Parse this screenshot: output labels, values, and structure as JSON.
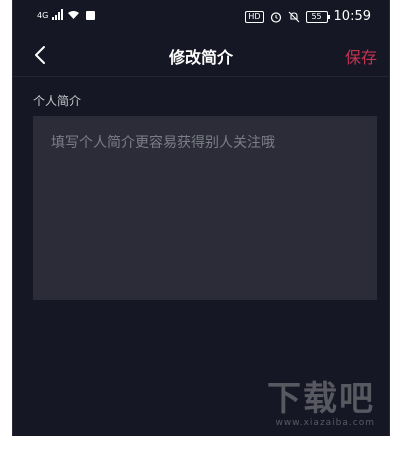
{
  "status_bar": {
    "network": "4G",
    "battery": "55",
    "time": "10:59"
  },
  "nav": {
    "title": "修改简介",
    "save_label": "保存"
  },
  "form": {
    "section_label": "个人简介",
    "bio_value": "",
    "bio_placeholder": "填写个人简介更容易获得别人关注哦"
  },
  "watermark": {
    "text": "下载吧",
    "url": "www.xiazaiba.com"
  }
}
